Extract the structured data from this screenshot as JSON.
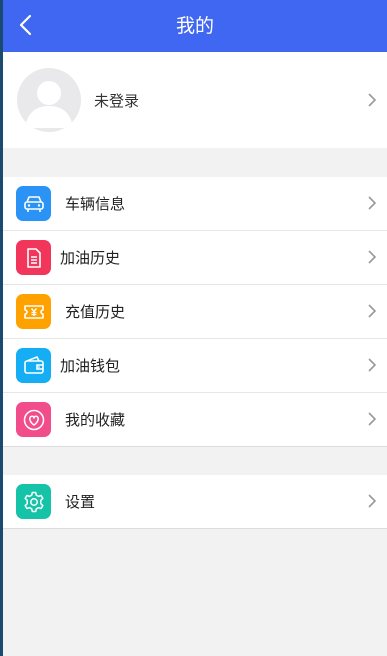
{
  "header": {
    "title": "我的"
  },
  "profile": {
    "login_label": "未登录"
  },
  "menu": {
    "items": [
      {
        "label": "车辆信息",
        "icon": "car-icon",
        "color": "#2a93f5"
      },
      {
        "label": "加油历史",
        "icon": "document-icon",
        "color": "#f2365b"
      },
      {
        "label": "充值历史",
        "icon": "ticket-icon",
        "color": "#ffa200"
      },
      {
        "label": "加油钱包",
        "icon": "wallet-icon",
        "color": "#15aef5"
      },
      {
        "label": "我的收藏",
        "icon": "heart-icon",
        "color": "#f24d8b"
      }
    ]
  },
  "settings": {
    "label": "设置",
    "icon": "gear-icon",
    "color": "#14c3a8"
  },
  "colors": {
    "header": "#3f67f1",
    "background": "#f2f2f2"
  }
}
